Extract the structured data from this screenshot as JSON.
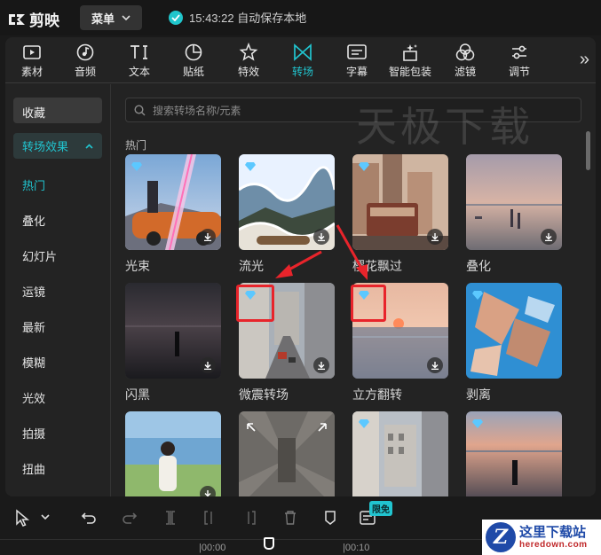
{
  "app": {
    "name": "剪映"
  },
  "header": {
    "menu_label": "菜单",
    "save_status": "15:43:22 自动保存本地"
  },
  "toolbar": {
    "tabs": [
      {
        "label": "素材",
        "icon": "media-icon"
      },
      {
        "label": "音频",
        "icon": "audio-icon"
      },
      {
        "label": "文本",
        "icon": "text-icon"
      },
      {
        "label": "贴纸",
        "icon": "sticker-icon"
      },
      {
        "label": "特效",
        "icon": "effects-icon"
      },
      {
        "label": "转场",
        "icon": "transition-icon",
        "active": true
      },
      {
        "label": "字幕",
        "icon": "subtitle-icon"
      },
      {
        "label": "智能包装",
        "icon": "smart-pack-icon"
      },
      {
        "label": "滤镜",
        "icon": "filter-icon"
      },
      {
        "label": "调节",
        "icon": "adjust-icon"
      }
    ],
    "more_label": "»"
  },
  "sidebar": {
    "favorites": "收藏",
    "category": "转场效果",
    "items": [
      "热门",
      "叠化",
      "幻灯片",
      "运镜",
      "最新",
      "模糊",
      "光效",
      "拍摄",
      "扭曲"
    ],
    "active_item": "热门"
  },
  "content": {
    "search_placeholder": "搜索转场名称/元素",
    "watermark": "天极下载",
    "section_title": "热门",
    "cards": [
      {
        "label": "光束",
        "premium": true
      },
      {
        "label": "流光",
        "premium": true
      },
      {
        "label": "樱花飘过",
        "premium": true
      },
      {
        "label": "叠化",
        "premium": false
      },
      {
        "label": "闪黑",
        "premium": false
      },
      {
        "label": "微震转场",
        "premium": true
      },
      {
        "label": "立方翻转",
        "premium": true
      },
      {
        "label": "剥离",
        "premium": true
      },
      {
        "label": "",
        "premium": false
      },
      {
        "label": "",
        "premium": false
      },
      {
        "label": "",
        "premium": true
      },
      {
        "label": "",
        "premium": true
      }
    ]
  },
  "bottombar": {
    "badge": "限免",
    "timecodes": [
      "|00:00",
      "|00:10"
    ]
  },
  "site_logo": {
    "cn": "这里下载站",
    "en": "heredown.com",
    "mark": "Z"
  },
  "colors": {
    "accent": "#21c4cf",
    "annotation": "#e8242b"
  }
}
